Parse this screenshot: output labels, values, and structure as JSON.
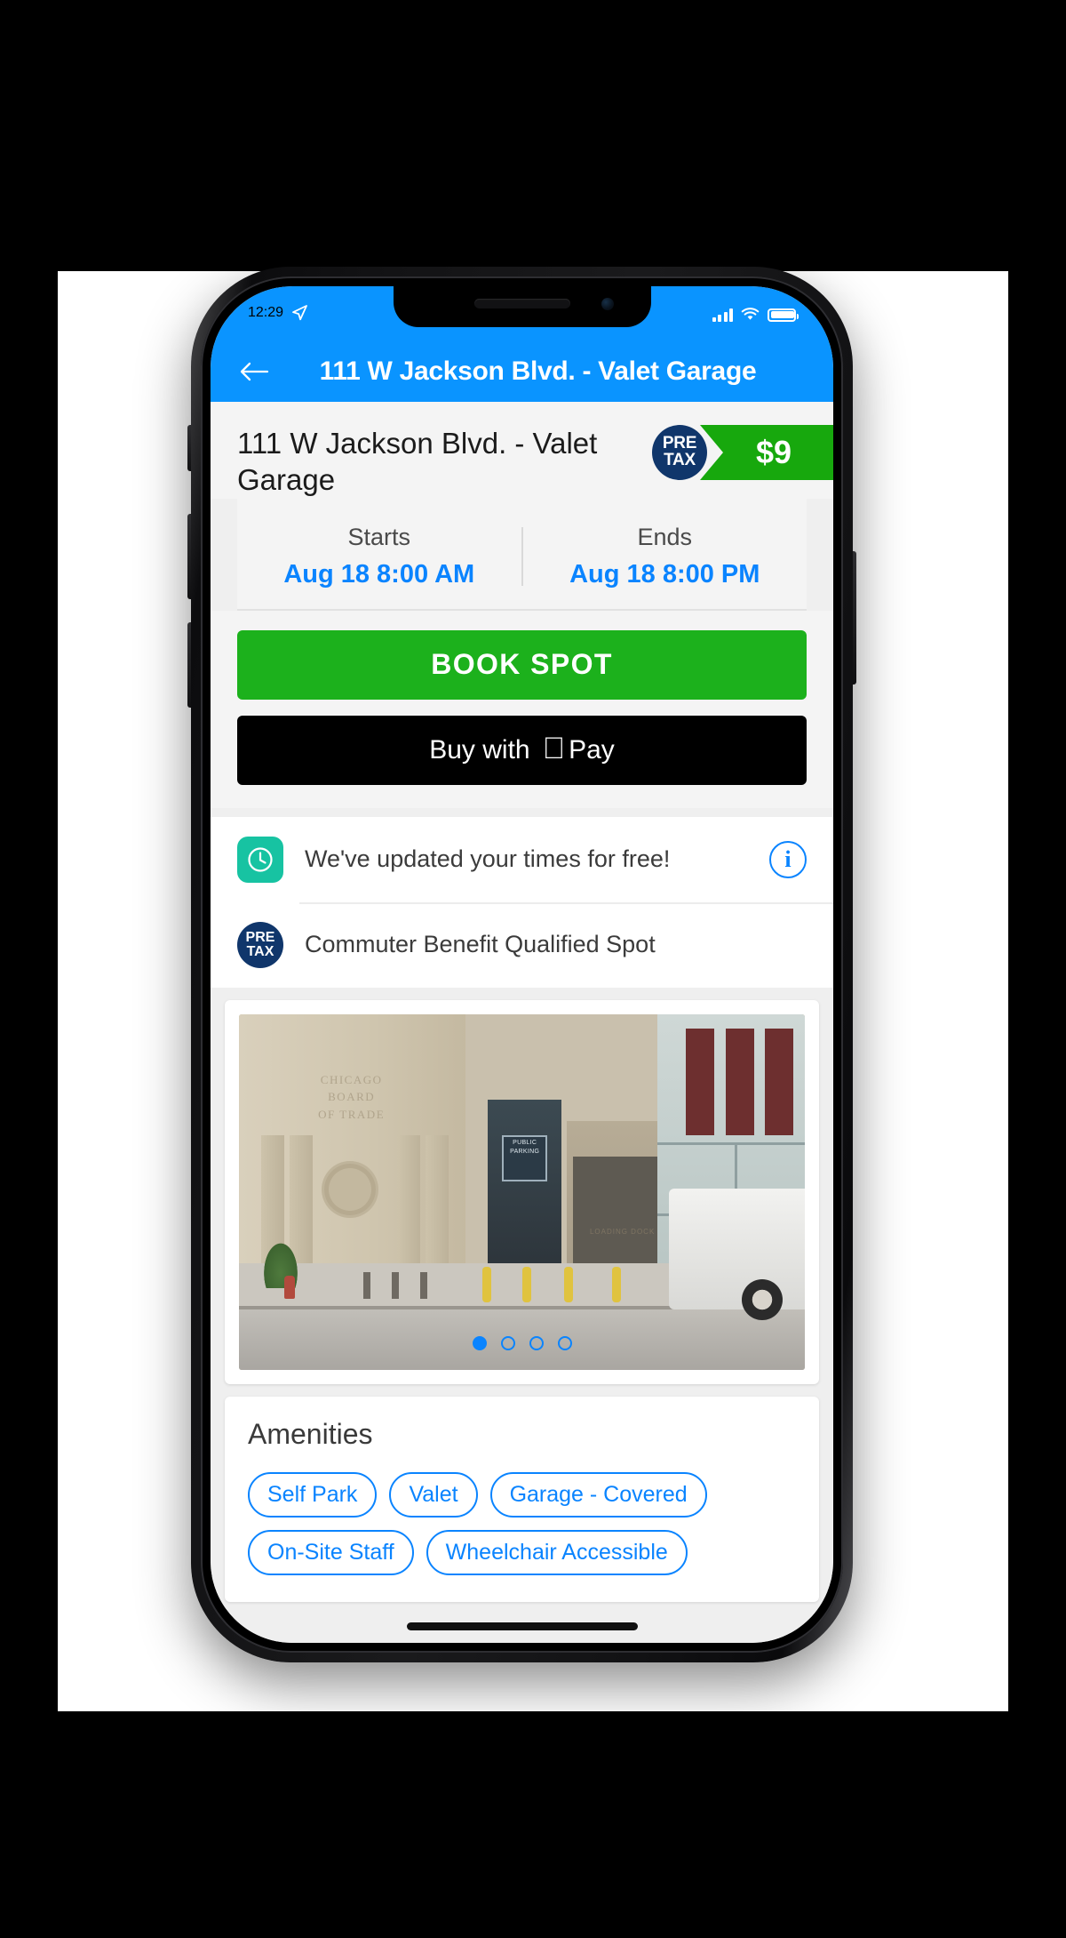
{
  "status_bar": {
    "time": "12:29",
    "location_icon": "location-arrow-icon",
    "signal_icon": "cellular-signal-icon",
    "wifi_icon": "wifi-icon",
    "battery_icon": "battery-full-icon"
  },
  "nav": {
    "back_icon": "back-arrow-icon",
    "title": "111 W Jackson Blvd. - Valet Garage"
  },
  "hero": {
    "title": "111 W Jackson Blvd. - Valet Garage",
    "pretax_line1": "PRE",
    "pretax_line2": "TAX",
    "price": "$9"
  },
  "times": {
    "starts_label": "Starts",
    "starts_value": "Aug 18 8:00 AM",
    "ends_label": "Ends",
    "ends_value": "Aug 18 8:00 PM"
  },
  "cta": {
    "book_label": "BOOK SPOT",
    "apple_pay_prefix": "Buy with",
    "apple_logo": "",
    "apple_pay_suffix": "Pay"
  },
  "info_rows": [
    {
      "icon": "clock-icon",
      "text": "We've updated your times for free!",
      "trailing_icon": "info-circle-icon",
      "trailing_label": "i"
    },
    {
      "icon": "pretax-badge-icon",
      "icon_line1": "PRE",
      "icon_line2": "TAX",
      "text": "Commuter Benefit Qualified Spot",
      "trailing_icon": "",
      "trailing_label": ""
    }
  ],
  "photo": {
    "building_sign_line1": "CHICAGO",
    "building_sign_line2": "BOARD",
    "building_sign_line3": "OF TRADE",
    "entry_sign_line1": "PUBLIC",
    "entry_sign_line2": "PARKING",
    "dock_label": "LOADING DOCK",
    "dots": [
      {
        "active": true
      },
      {
        "active": false
      },
      {
        "active": false
      },
      {
        "active": false
      }
    ]
  },
  "amenities": {
    "title": "Amenities",
    "chips": [
      "Self Park",
      "Valet",
      "Garage - Covered",
      "On-Site Staff",
      "Wheelchair Accessible"
    ]
  },
  "colors": {
    "accent_blue": "#0a84ff",
    "status_blue": "#0a94ff",
    "green_price": "#17a80d",
    "green_button": "#1cb11c",
    "navy_badge": "#10366b",
    "teal_icon": "#17c3a2"
  }
}
